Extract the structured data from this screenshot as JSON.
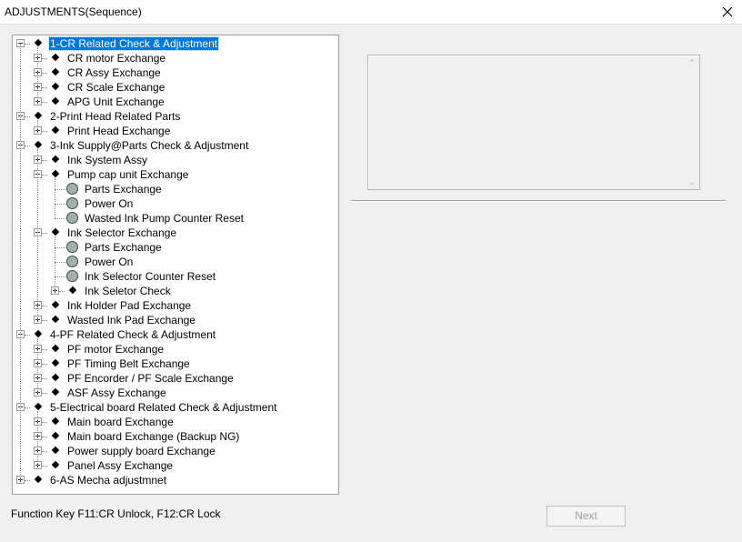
{
  "window": {
    "title": "ADJUSTMENTS(Sequence)"
  },
  "tree": {
    "items": [
      {
        "label": "1-CR Related Check & Adjustment",
        "level": 0,
        "state": "expanded",
        "icon": "diamond-icon",
        "selected": true
      },
      {
        "label": "CR motor Exchange",
        "level": 1,
        "state": "collapsed",
        "icon": "diamond-icon"
      },
      {
        "label": "CR Assy Exchange",
        "level": 1,
        "state": "collapsed",
        "icon": "diamond-icon"
      },
      {
        "label": "CR Scale Exchange",
        "level": 1,
        "state": "collapsed",
        "icon": "diamond-icon"
      },
      {
        "label": "APG Unit Exchange",
        "level": 1,
        "state": "collapsed",
        "icon": "diamond-icon"
      },
      {
        "label": "2-Print Head Related Parts",
        "level": 0,
        "state": "expanded",
        "icon": "diamond-icon"
      },
      {
        "label": "Print Head Exchange",
        "level": 1,
        "state": "collapsed",
        "icon": "diamond-icon"
      },
      {
        "label": "3-Ink Supply@Parts Check & Adjustment",
        "level": 0,
        "state": "expanded",
        "icon": "diamond-icon"
      },
      {
        "label": "Ink System Assy",
        "level": 1,
        "state": "collapsed",
        "icon": "diamond-icon"
      },
      {
        "label": "Pump cap unit Exchange",
        "level": 1,
        "state": "expanded",
        "icon": "diamond-icon"
      },
      {
        "label": "Parts Exchange",
        "level": 2,
        "state": "leaf",
        "icon": "circle-icon"
      },
      {
        "label": "Power On",
        "level": 2,
        "state": "leaf",
        "icon": "circle-icon"
      },
      {
        "label": "Wasted Ink Pump  Counter Reset",
        "level": 2,
        "state": "leaf",
        "icon": "circle-icon"
      },
      {
        "label": "Ink Selector Exchange",
        "level": 1,
        "state": "expanded",
        "icon": "diamond-icon"
      },
      {
        "label": "Parts Exchange",
        "level": 2,
        "state": "leaf",
        "icon": "circle-icon"
      },
      {
        "label": "Power On",
        "level": 2,
        "state": "leaf",
        "icon": "circle-icon"
      },
      {
        "label": "Ink Selector Counter Reset",
        "level": 2,
        "state": "leaf",
        "icon": "circle-icon"
      },
      {
        "label": "Ink Seletor Check",
        "level": 2,
        "state": "collapsed",
        "icon": "diamond-icon"
      },
      {
        "label": "Ink Holder Pad Exchange",
        "level": 1,
        "state": "collapsed",
        "icon": "diamond-icon"
      },
      {
        "label": "Wasted Ink Pad Exchange",
        "level": 1,
        "state": "collapsed",
        "icon": "diamond-icon"
      },
      {
        "label": "4-PF Related Check & Adjustment",
        "level": 0,
        "state": "expanded",
        "icon": "diamond-icon"
      },
      {
        "label": "PF motor Exchange",
        "level": 1,
        "state": "collapsed",
        "icon": "diamond-icon"
      },
      {
        "label": "PF Timing Belt Exchange",
        "level": 1,
        "state": "collapsed",
        "icon": "diamond-icon"
      },
      {
        "label": "PF Encorder / PF Scale Exchange",
        "level": 1,
        "state": "collapsed",
        "icon": "diamond-icon"
      },
      {
        "label": "ASF Assy Exchange",
        "level": 1,
        "state": "collapsed",
        "icon": "diamond-icon"
      },
      {
        "label": "5-Electrical board Related Check & Adjustment",
        "level": 0,
        "state": "expanded",
        "icon": "diamond-icon"
      },
      {
        "label": "Main board Exchange",
        "level": 1,
        "state": "collapsed",
        "icon": "diamond-icon"
      },
      {
        "label": "Main board Exchange (Backup NG)",
        "level": 1,
        "state": "collapsed",
        "icon": "diamond-icon"
      },
      {
        "label": "Power supply board Exchange",
        "level": 1,
        "state": "collapsed",
        "icon": "diamond-icon"
      },
      {
        "label": "Panel Assy Exchange",
        "level": 1,
        "state": "collapsed",
        "icon": "diamond-icon"
      },
      {
        "label": "6-AS Mecha adjustmnet",
        "level": 0,
        "state": "collapsed",
        "icon": "diamond-icon"
      }
    ]
  },
  "status": {
    "function_key_text": "Function Key F11:CR Unlock, F12:CR Lock"
  },
  "buttons": {
    "next_label": "Next",
    "next_enabled": false
  },
  "colors": {
    "selection": "#0078d7",
    "background": "#f0f0f0"
  }
}
